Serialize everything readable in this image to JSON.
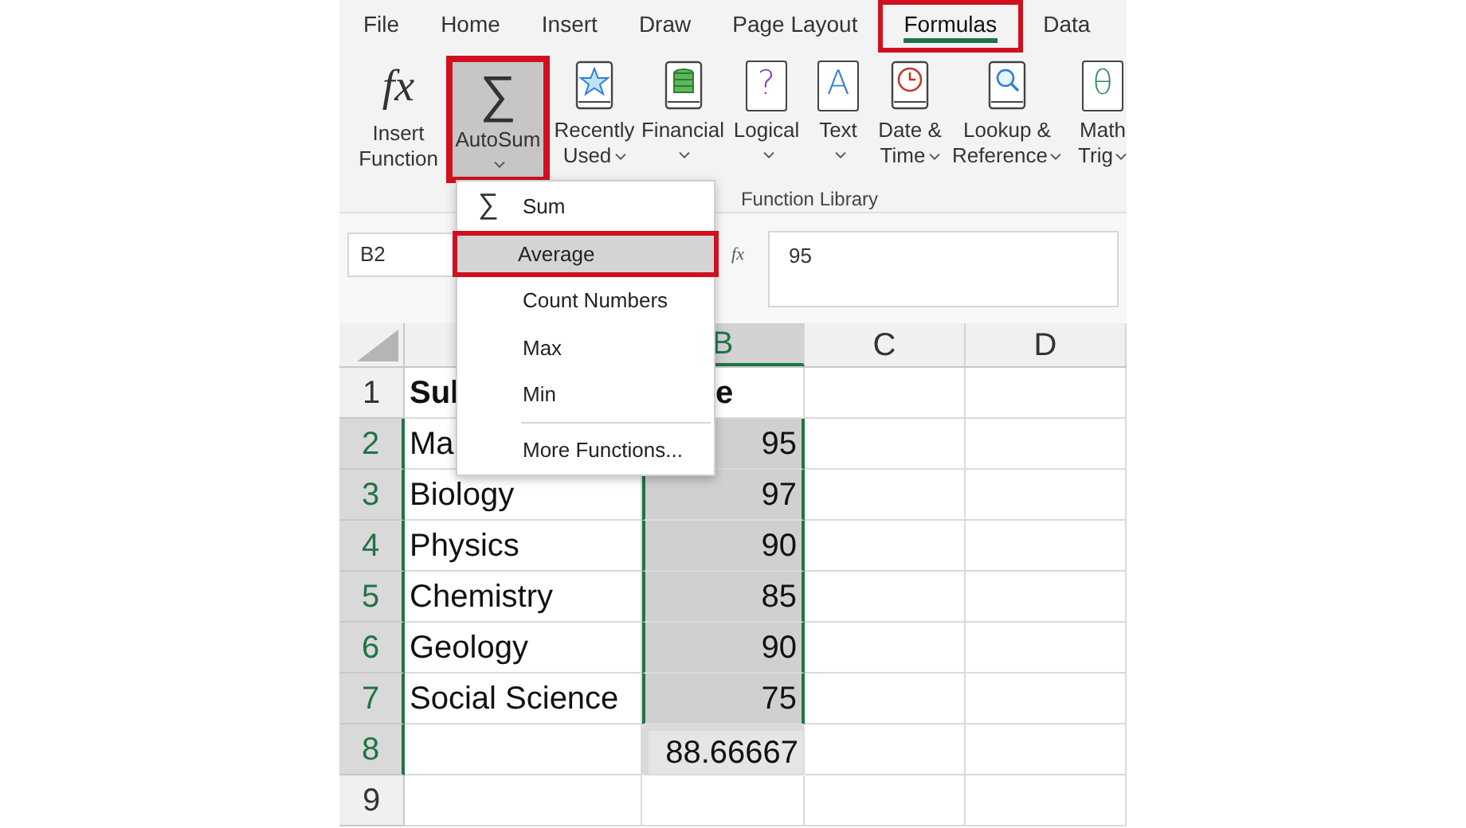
{
  "ribbon_tabs": [
    {
      "label": "File",
      "selected": false,
      "highlighted": false
    },
    {
      "label": "Home",
      "selected": false,
      "highlighted": false
    },
    {
      "label": "Insert",
      "selected": false,
      "highlighted": false
    },
    {
      "label": "Draw",
      "selected": false,
      "highlighted": false
    },
    {
      "label": "Page Layout",
      "selected": false,
      "highlighted": false
    },
    {
      "label": "Formulas",
      "selected": true,
      "highlighted": true
    },
    {
      "label": "Data",
      "selected": false,
      "highlighted": false
    }
  ],
  "ribbon_buttons": [
    {
      "kind": "glyph",
      "glyph": "fx",
      "lines": [
        "Insert",
        "Function"
      ],
      "dropdown": false,
      "pressed": false,
      "highlighted": false
    },
    {
      "kind": "glyph",
      "glyph": "∑",
      "lines": [
        "AutoSum"
      ],
      "dropdown": true,
      "pressed": true,
      "highlighted": true
    },
    {
      "kind": "star",
      "lines": [
        "Recently",
        "Used"
      ],
      "dropdown": true,
      "pressed": false,
      "highlighted": false
    },
    {
      "kind": "database",
      "lines": [
        "Financial"
      ],
      "dropdown": true,
      "pressed": false,
      "highlighted": false
    },
    {
      "kind": "book",
      "glyph": "?",
      "color": "#8a3fbf",
      "lines": [
        "Logical"
      ],
      "dropdown": true,
      "pressed": false,
      "highlighted": false
    },
    {
      "kind": "book",
      "glyph": "A",
      "color": "#2f7fd6",
      "lines": [
        "Text"
      ],
      "dropdown": true,
      "pressed": false,
      "highlighted": false
    },
    {
      "kind": "clock",
      "lines": [
        "Date &",
        "Time"
      ],
      "dropdown": true,
      "pressed": false,
      "highlighted": false
    },
    {
      "kind": "magnifier",
      "lines": [
        "Lookup &",
        "Reference"
      ],
      "dropdown": true,
      "pressed": false,
      "highlighted": false
    },
    {
      "kind": "book",
      "glyph": "θ",
      "color": "#2e8b57",
      "lines": [
        "Math",
        "Trig"
      ],
      "dropdown": true,
      "pressed": false,
      "highlighted": false
    }
  ],
  "group_label": "Function Library",
  "formula_bar": {
    "name_box": "B2",
    "fx": "fx",
    "value": "95"
  },
  "autosum_menu": [
    {
      "label": "Sum",
      "icon": "∑",
      "selected": false,
      "highlighted": false
    },
    {
      "label": "Average",
      "selected": true,
      "highlighted": true
    },
    {
      "label": "Count Numbers",
      "selected": false,
      "highlighted": false
    },
    {
      "label": "Max",
      "selected": false,
      "highlighted": false
    },
    {
      "label": "Min",
      "selected": false,
      "highlighted": false
    },
    {
      "label": "More Functions...",
      "selected": false,
      "highlighted": false,
      "separator_above": true
    }
  ],
  "column_headers": [
    {
      "label": "B",
      "selected": true
    },
    {
      "label": "C",
      "selected": false
    },
    {
      "label": "D",
      "selected": false
    }
  ],
  "rows": [
    {
      "header": "1",
      "selected": false,
      "cells": [
        {
          "text": "Sul",
          "kind": "text",
          "bold": true,
          "selected": false,
          "highlighted": false
        },
        {
          "text": "e",
          "kind": "cut",
          "bold": true,
          "selected": false,
          "highlighted": false
        },
        {
          "selected": false
        },
        {
          "selected": false
        }
      ]
    },
    {
      "header": "2",
      "selected": true,
      "cells": [
        {
          "text": "Ma",
          "kind": "text",
          "bold": false,
          "selected": false,
          "highlighted": false
        },
        {
          "text": "95",
          "kind": "number",
          "bold": false,
          "selected": true,
          "highlighted": false
        },
        {
          "selected": false
        },
        {
          "selected": false
        }
      ]
    },
    {
      "header": "3",
      "selected": true,
      "cells": [
        {
          "text": "Biology",
          "kind": "text",
          "bold": false,
          "selected": false,
          "highlighted": false
        },
        {
          "text": "97",
          "kind": "number",
          "bold": false,
          "selected": true,
          "highlighted": false
        },
        {
          "selected": false
        },
        {
          "selected": false
        }
      ]
    },
    {
      "header": "4",
      "selected": true,
      "cells": [
        {
          "text": "Physics",
          "kind": "text",
          "bold": false,
          "selected": false,
          "highlighted": false
        },
        {
          "text": "90",
          "kind": "number",
          "bold": false,
          "selected": true,
          "highlighted": false
        },
        {
          "selected": false
        },
        {
          "selected": false
        }
      ]
    },
    {
      "header": "5",
      "selected": true,
      "cells": [
        {
          "text": "Chemistry",
          "kind": "text",
          "bold": false,
          "selected": false,
          "highlighted": false
        },
        {
          "text": "85",
          "kind": "number",
          "bold": false,
          "selected": true,
          "highlighted": false
        },
        {
          "selected": false
        },
        {
          "selected": false
        }
      ]
    },
    {
      "header": "6",
      "selected": true,
      "cells": [
        {
          "text": "Geology",
          "kind": "text",
          "bold": false,
          "selected": false,
          "highlighted": false
        },
        {
          "text": "90",
          "kind": "number",
          "bold": false,
          "selected": true,
          "highlighted": false
        },
        {
          "selected": false
        },
        {
          "selected": false
        }
      ]
    },
    {
      "header": "7",
      "selected": true,
      "cells": [
        {
          "text": "Social Science",
          "kind": "text",
          "bold": false,
          "selected": false,
          "highlighted": false
        },
        {
          "text": "75",
          "kind": "number",
          "bold": false,
          "selected": true,
          "highlighted": false
        },
        {
          "selected": false
        },
        {
          "selected": false
        }
      ]
    },
    {
      "header": "8",
      "selected": true,
      "cells": [
        {
          "selected": false
        },
        {
          "text": "88.66667",
          "kind": "number",
          "bold": false,
          "selected": false,
          "highlighted": true
        },
        {
          "selected": false
        },
        {
          "selected": false
        }
      ]
    },
    {
      "header": "9",
      "selected": false,
      "cells": [
        {
          "selected": false
        },
        {
          "selected": false
        },
        {
          "selected": false
        },
        {
          "selected": false
        }
      ]
    }
  ]
}
